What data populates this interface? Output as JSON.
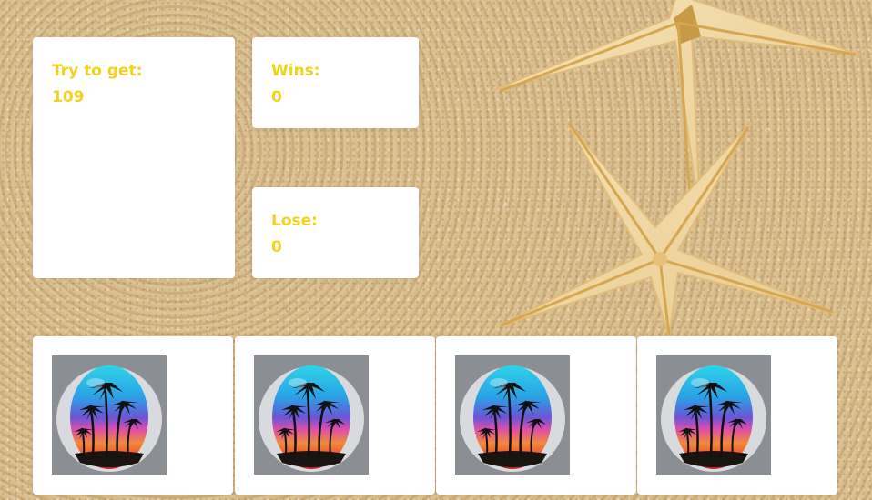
{
  "scoreboard": {
    "target_label": "Try to get:",
    "target_value": "109",
    "wins_label": "Wins:",
    "wins_value": "0",
    "lose_label": "Lose:",
    "lose_value": "0"
  },
  "crystals": [
    {
      "icon": "palm-beach-stone-icon"
    },
    {
      "icon": "palm-beach-stone-icon"
    },
    {
      "icon": "palm-beach-stone-icon"
    },
    {
      "icon": "palm-beach-stone-icon"
    }
  ],
  "colors": {
    "text_accent": "#f2d21c",
    "panel_bg": "#ffffff",
    "sand": "#d4b889"
  }
}
